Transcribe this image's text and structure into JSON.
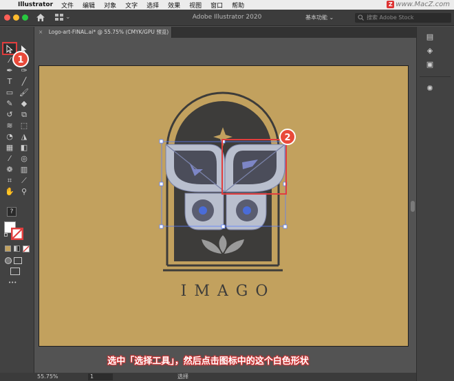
{
  "menubar": {
    "app_name": "Illustrator",
    "items": [
      "文件",
      "编辑",
      "对象",
      "文字",
      "选择",
      "效果",
      "视图",
      "窗口",
      "帮助"
    ],
    "watermark": "www.MacZ.com"
  },
  "titlebar": {
    "title": "Adobe Illustrator 2020",
    "workspace": "基本功能",
    "search_placeholder": "搜索 Adobe Stock",
    "chevron": "⌄"
  },
  "document_tab": {
    "close": "×",
    "label": "Logo-art-FINAL.ai* @ 55.75% (CMYK/GPU 预览)"
  },
  "artwork": {
    "brand_text": "IMAGO"
  },
  "annotations": {
    "step1": "1",
    "step2": "2",
    "caption": "选中「选择工具」，然后点击图标中的这个白色形状"
  },
  "toolbar": {
    "question": "?",
    "more": "•••"
  },
  "statusbar": {
    "zoom": "55.75%",
    "page": "1",
    "current_tool": "选择"
  },
  "colors": {
    "artboard": "#c2a15e",
    "dark_shape": "#3d3c3a",
    "light_shape": "#b9bfce",
    "annotation_red": "#e94a3a"
  }
}
